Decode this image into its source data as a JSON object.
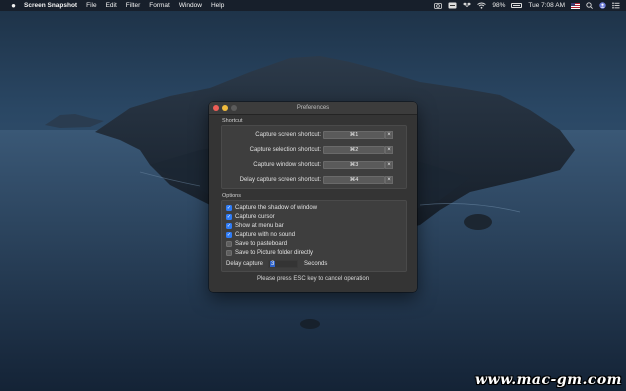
{
  "menubar": {
    "apple_icon": "apple-icon",
    "app_name": "Screen Snapshot",
    "menus": [
      "File",
      "Edit",
      "Filter",
      "Format",
      "Window",
      "Help"
    ],
    "battery_percent": "98%",
    "clock": "Tue 7:08 AM"
  },
  "window": {
    "title": "Preferences",
    "shortcut_section": {
      "label": "Shortcut",
      "rows": [
        {
          "label": "Capture screen shortcut:",
          "value": "⌘1",
          "clear": "×"
        },
        {
          "label": "Capture selection shortcut:",
          "value": "⌘2",
          "clear": "×"
        },
        {
          "label": "Capture window shortcut:",
          "value": "⌘3",
          "clear": "×"
        },
        {
          "label": "Delay capture screen shortcut:",
          "value": "⌘4",
          "clear": "×"
        }
      ]
    },
    "options_section": {
      "label": "Options",
      "options": [
        {
          "label": "Capture the shadow of window",
          "checked": true
        },
        {
          "label": "Capture cursor",
          "checked": true
        },
        {
          "label": "Show at menu bar",
          "checked": true
        },
        {
          "label": "Capture with no sound",
          "checked": true
        },
        {
          "label": "Save to pasteboard",
          "checked": false
        },
        {
          "label": "Save to Picture folder directly",
          "checked": false
        }
      ],
      "delay": {
        "label": "Delay capture",
        "value": "3",
        "unit": "Seconds"
      }
    },
    "hint": "Please press ESC key to cancel operation"
  },
  "watermark": "www.mac-gm.com",
  "colors": {
    "accent": "#2f7cf6",
    "close": "#ee5e57",
    "minimize": "#f1bb3d"
  }
}
